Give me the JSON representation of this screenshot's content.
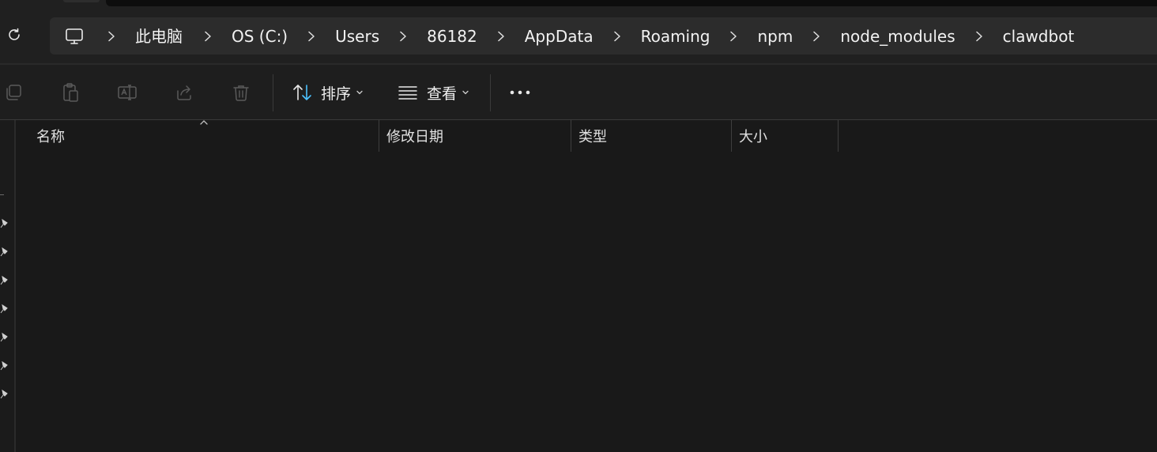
{
  "address_bar": {
    "root_icon": "computer-icon",
    "breadcrumbs": [
      "此电脑",
      "OS (C:)",
      "Users",
      "86182",
      "AppData",
      "Roaming",
      "npm",
      "node_modules",
      "clawdbot"
    ],
    "separator_icon": "chevron-right-icon",
    "refresh_icon": "refresh-icon"
  },
  "toolbar": {
    "copy_icon": "copy-icon",
    "paste_icon": "paste-icon",
    "rename_icon": "rename-icon",
    "share_icon": "share-icon",
    "delete_icon": "trash-icon",
    "sort_label": "排序",
    "sort_icon": "sort-arrows-icon",
    "view_label": "查看",
    "view_icon": "list-view-icon",
    "more_icon": "more-dots-icon"
  },
  "columns": {
    "headers": [
      "名称",
      "修改日期",
      "类型",
      "大小"
    ],
    "sorted_column": "名称",
    "sort_direction": "ascending"
  },
  "files": [],
  "colors": {
    "background": "#191919",
    "address_bar": "#2c2c2c",
    "accent_sort_arrow": "#4cc2ff",
    "text": "#f2f2f2"
  }
}
